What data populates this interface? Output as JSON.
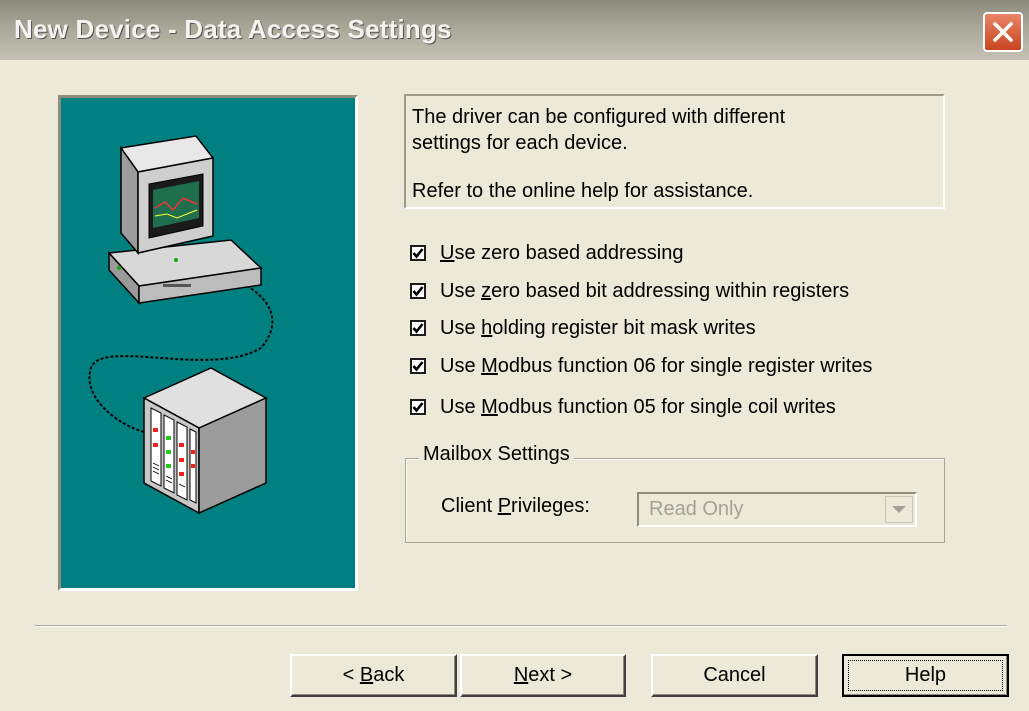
{
  "window": {
    "title": "New Device - Data Access Settings",
    "close_glyph": "close-icon"
  },
  "info": {
    "line1": "The driver can be configured with different",
    "line2": "settings for each device.",
    "line3": "Refer to the online help for assistance."
  },
  "options": [
    {
      "pre": "",
      "accel": "U",
      "post": "se zero based addressing",
      "checked": true
    },
    {
      "pre": "Use ",
      "accel": "z",
      "post": "ero based bit addressing within registers",
      "checked": true
    },
    {
      "pre": "Use ",
      "accel": "h",
      "post": "olding register bit mask writes",
      "checked": true
    },
    {
      "pre": "Use ",
      "accel": "M",
      "post": "odbus function 06 for single register writes",
      "checked": true
    },
    {
      "pre": "Use ",
      "accel": "M",
      "post": "odbus function 05 for single coil writes",
      "checked": true
    }
  ],
  "mailbox": {
    "group_label": "Mailbox Settings",
    "privileges_pre": "Client ",
    "privileges_accel": "P",
    "privileges_post": "rivileges:",
    "privileges_value": "Read Only"
  },
  "buttons": {
    "back_pre": "< ",
    "back_accel": "B",
    "back_post": "ack",
    "next_accel": "N",
    "next_post": "ext >",
    "cancel": "Cancel",
    "help": "Help"
  },
  "colors": {
    "illustration_bg": "#008080",
    "dialog_bg": "#ece9d8",
    "close_button": "#d6532e"
  }
}
